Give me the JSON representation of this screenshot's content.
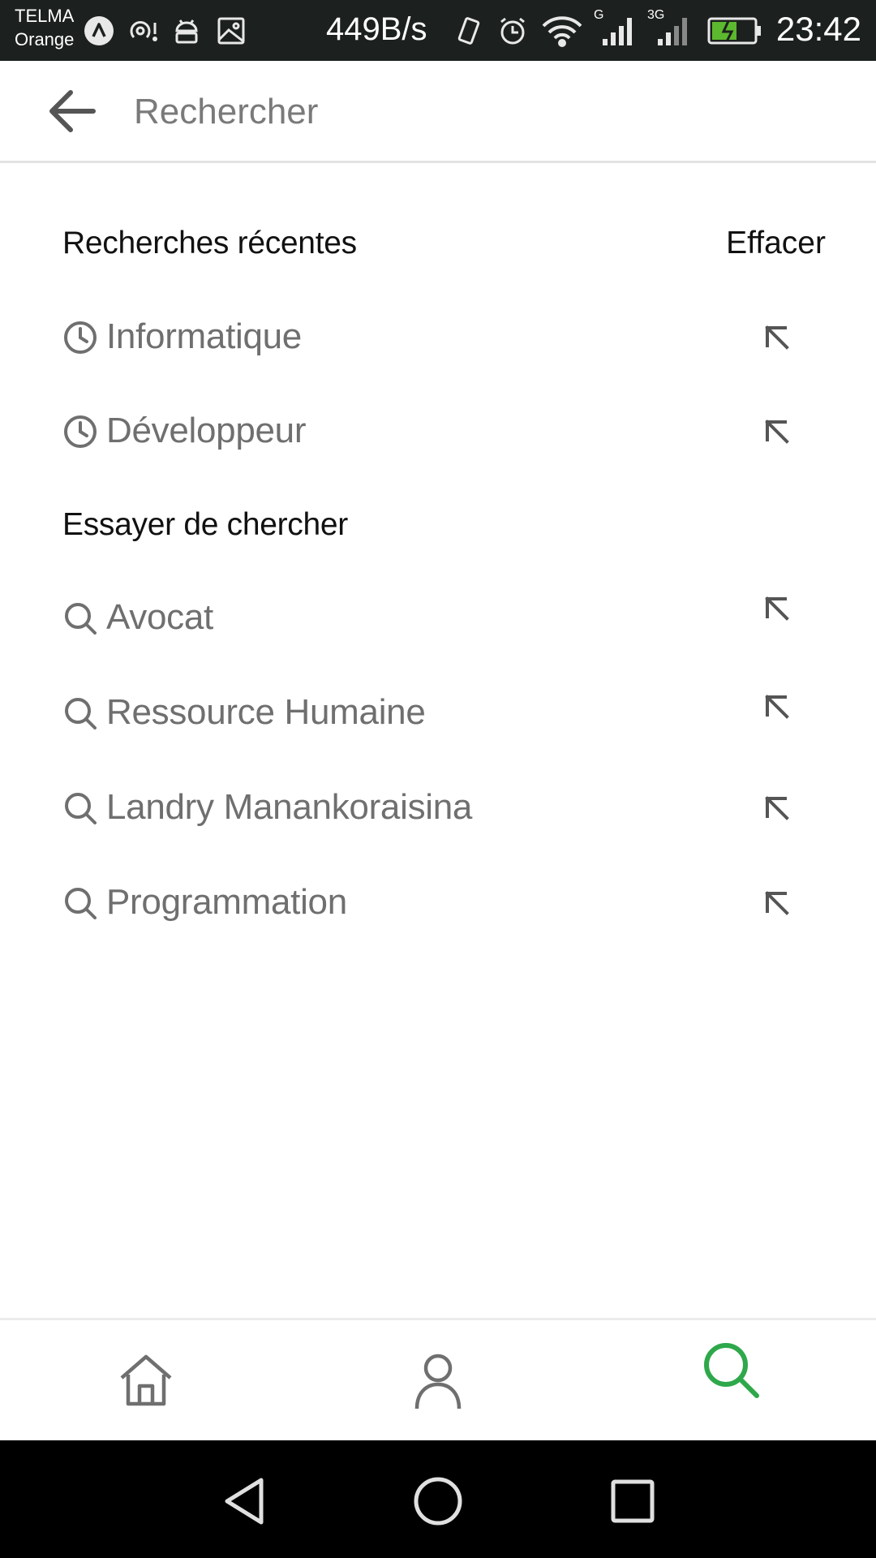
{
  "status_bar": {
    "carrier_line1": "TELMA",
    "carrier_line2": "Orange",
    "network_speed": "449B/s",
    "signal_label_1": "G",
    "signal_label_2": "3G",
    "time": "23:42",
    "battery_color": "#5cb82e"
  },
  "header": {
    "back_icon": "arrow-left-icon",
    "search_placeholder": "Rechercher"
  },
  "recent": {
    "title": "Recherches récentes",
    "clear_label": "Effacer",
    "items": [
      {
        "label": "Informatique",
        "icon": "clock-icon"
      },
      {
        "label": "Développeur",
        "icon": "clock-icon"
      }
    ]
  },
  "suggestions": {
    "title": "Essayer de chercher",
    "items": [
      {
        "label": "Avocat",
        "icon": "search-icon"
      },
      {
        "label": "Ressource Humaine",
        "icon": "search-icon"
      },
      {
        "label": "Landry Manankoraisina",
        "icon": "search-icon"
      },
      {
        "label": "Programmation",
        "icon": "search-icon"
      }
    ]
  },
  "bottom_nav": {
    "items": [
      {
        "icon": "home-icon",
        "active": false
      },
      {
        "icon": "profile-icon",
        "active": false
      },
      {
        "icon": "search-icon",
        "active": true
      }
    ],
    "active_color": "#2ea84a",
    "inactive_color": "#6f6f6f"
  }
}
